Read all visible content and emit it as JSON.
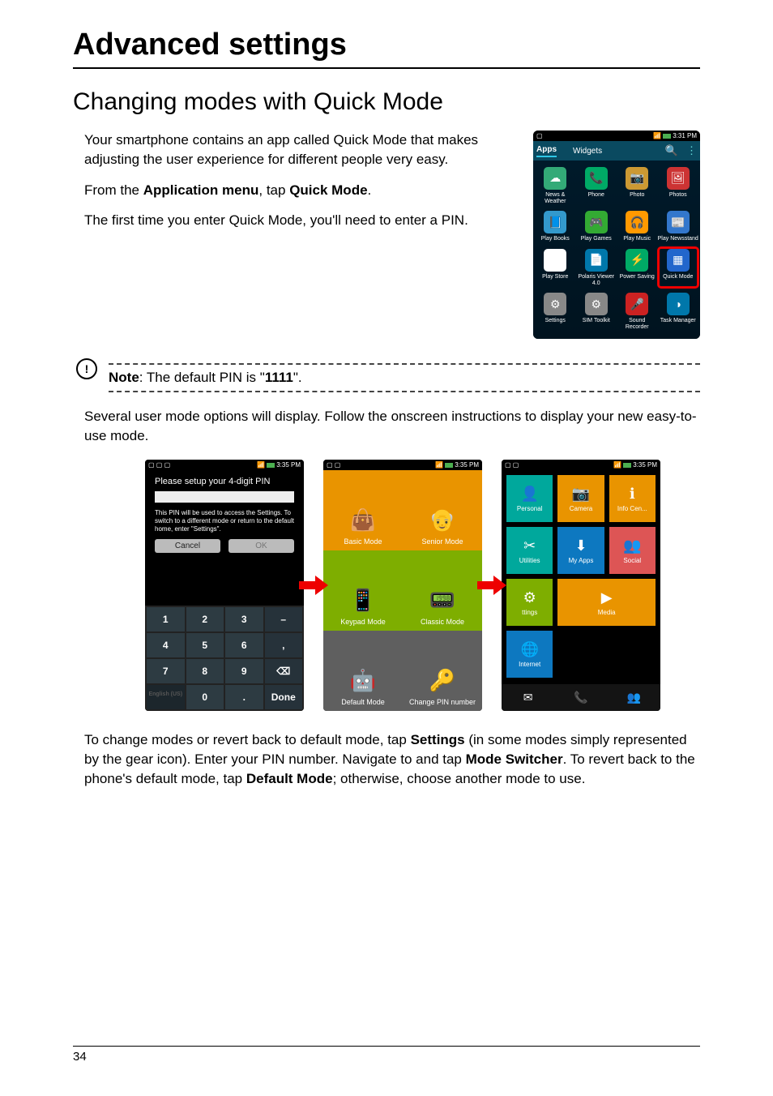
{
  "title": "Advanced settings",
  "section": "Changing modes with Quick Mode",
  "intro": {
    "p1": "Your smartphone contains an app called Quick Mode that makes adjusting the user experience for different people very easy.",
    "p2_pre": "From the ",
    "p2_b1": "Application menu",
    "p2_mid": ", tap ",
    "p2_b2": "Quick Mode",
    "p2_post": ".",
    "p3": "The first time you enter Quick Mode, you'll need to enter a PIN."
  },
  "note": {
    "label": "Note",
    "mid": ": The default PIN is \"",
    "pin": "1111",
    "post": "\"."
  },
  "after_note": "Several user mode options will display. Follow the onscreen instructions to display your new easy-to-use mode.",
  "closing": {
    "pre": "To change modes or revert back to default mode, tap ",
    "b1": "Settings",
    "mid1": " (in some modes simply represented by the gear icon). Enter your PIN number. Navigate to and tap ",
    "b2": "Mode Switcher",
    "mid2": ". To revert back to the phone's default mode, tap ",
    "b3": "Default Mode",
    "post": "; otherwise, choose another mode to use."
  },
  "page_number": "34",
  "screenshot_apps": {
    "status_time": "3:31 PM",
    "tabs": {
      "apps": "Apps",
      "widgets": "Widgets"
    },
    "items": [
      {
        "label": "News & Weather",
        "color": "#3a7",
        "glyph": "☁"
      },
      {
        "label": "Phone",
        "color": "#0a6",
        "glyph": "📞"
      },
      {
        "label": "Photo",
        "color": "#c93",
        "glyph": "📷"
      },
      {
        "label": "Photos",
        "color": "#c33",
        "glyph": "🖼"
      },
      {
        "label": "Play Books",
        "color": "#39c",
        "glyph": "📘"
      },
      {
        "label": "Play Games",
        "color": "#3a3",
        "glyph": "🎮"
      },
      {
        "label": "Play Music",
        "color": "#f90",
        "glyph": "🎧"
      },
      {
        "label": "Play Newsstand",
        "color": "#37c",
        "glyph": "📰"
      },
      {
        "label": "Play Store",
        "color": "#fff",
        "glyph": "▶"
      },
      {
        "label": "Polaris Viewer 4.0",
        "color": "#07a",
        "glyph": "📄"
      },
      {
        "label": "Power Saving",
        "color": "#0a6",
        "glyph": "⚡"
      },
      {
        "label": "Quick Mode",
        "color": "#26c",
        "glyph": "▦",
        "hl": true
      },
      {
        "label": "Settings",
        "color": "#888",
        "glyph": "⚙"
      },
      {
        "label": "SIM Toolkit",
        "color": "#888",
        "glyph": "⚙"
      },
      {
        "label": "Sound Recorder",
        "color": "#c22",
        "glyph": "🎤"
      },
      {
        "label": "Task Manager",
        "color": "#07a",
        "glyph": "◑"
      }
    ]
  },
  "shot1": {
    "status_time": "3:35 PM",
    "title": "Please setup your 4-digit PIN",
    "desc": "This PIN will be used to access the Settings. To switch to a different mode or return to the default home, enter \"Settings\".",
    "cancel": "Cancel",
    "ok": "OK",
    "keys": [
      "1",
      "2",
      "3",
      "–",
      "4",
      "5",
      "6",
      ",",
      "7",
      "8",
      "9",
      "⌫",
      "English (US)",
      "0",
      ".",
      "Done"
    ],
    "lang": "English (US)"
  },
  "shot2": {
    "status_time": "3:35 PM",
    "tiles": [
      {
        "label": "Basic Mode",
        "cls": "orange",
        "glyph": "👜"
      },
      {
        "label": "Senior Mode",
        "cls": "orange",
        "glyph": "👴"
      },
      {
        "label": "Keypad Mode",
        "cls": "olive",
        "glyph": "📱"
      },
      {
        "label": "Classic Mode",
        "cls": "olive",
        "glyph": "📟"
      },
      {
        "label": "Default Mode",
        "cls": "gray",
        "glyph": "🤖"
      },
      {
        "label": "Change PIN number",
        "cls": "gray",
        "glyph": "🔑"
      }
    ]
  },
  "shot3": {
    "status_time": "3:35 PM",
    "tiles": [
      {
        "label": "Personal",
        "cls": "teal",
        "glyph": "👤"
      },
      {
        "label": "Camera",
        "cls": "orangebg",
        "glyph": "📷"
      },
      {
        "label": "Info Cen...",
        "cls": "orangebg",
        "glyph": "ℹ"
      },
      {
        "label": "Utilities",
        "cls": "teal",
        "glyph": "✂"
      },
      {
        "label": "My Apps",
        "cls": "bluebg",
        "glyph": "⬇"
      },
      {
        "label": "Social",
        "cls": "redbg",
        "glyph": "👥"
      },
      {
        "label": "ttings",
        "cls": "olivebg",
        "glyph": "⚙"
      },
      {
        "label": "Media",
        "cls": "orangebg",
        "glyph": "▶",
        "wide": true
      },
      {
        "label": "Internet",
        "cls": "bluebg",
        "glyph": "🌐"
      }
    ],
    "bottom": [
      "✉",
      "📞",
      "👥"
    ]
  }
}
